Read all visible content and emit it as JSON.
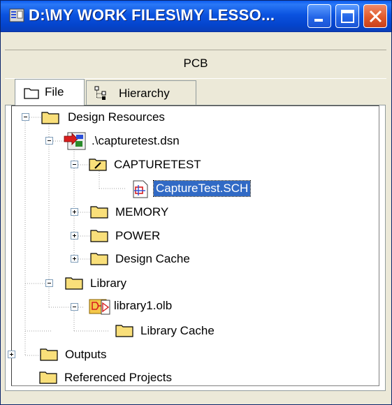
{
  "window": {
    "title": "D:\\MY WORK FILES\\MY LESSO...",
    "pane_header": "PCB"
  },
  "tabs": [
    {
      "label": "File",
      "icon": "folder-icon",
      "active": true
    },
    {
      "label": "Hierarchy",
      "icon": "hierarchy-icon",
      "active": false
    }
  ],
  "tree": {
    "design_resources": "Design Resources",
    "design_file": ".\\capturetest.dsn",
    "capturetest": "CAPTURETEST",
    "schematic": "CaptureTest.SCH",
    "memory": "MEMORY",
    "power": "POWER",
    "design_cache": "Design Cache",
    "library": "Library",
    "library_file": "library1.olb",
    "library_cache": "Library Cache",
    "outputs": "Outputs",
    "referenced_projects": "Referenced Projects"
  },
  "colors": {
    "title_bar": "#0b53e0",
    "selection": "#316ac5",
    "folder": "#f9df7a",
    "close_button": "#e05a2b"
  }
}
